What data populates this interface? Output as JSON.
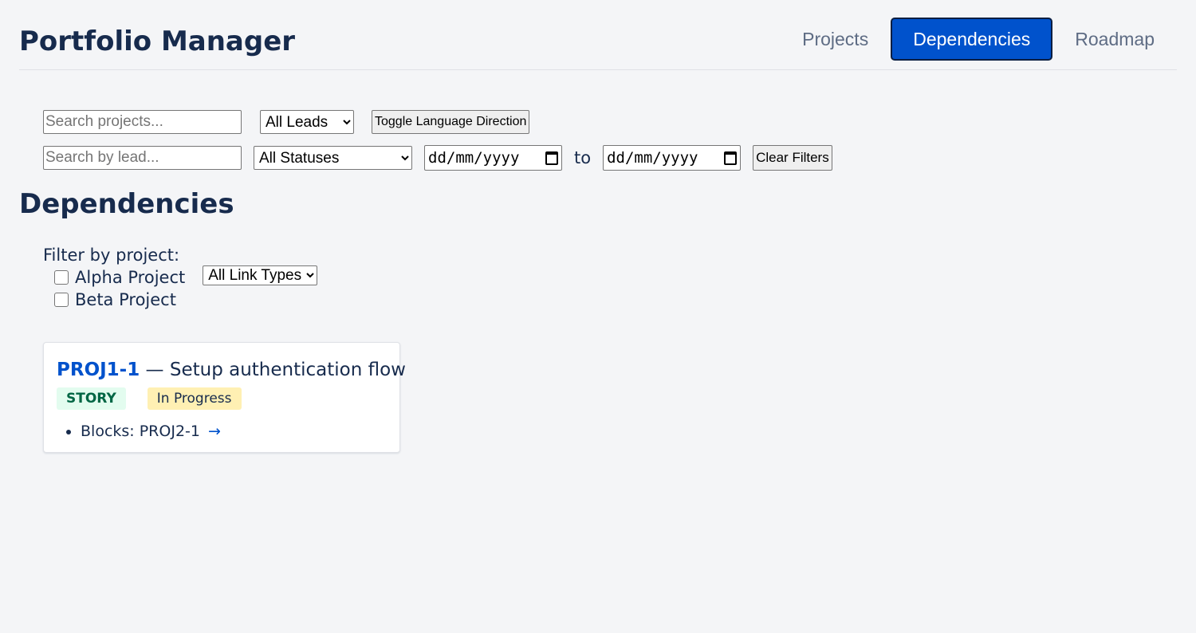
{
  "header": {
    "title": "Portfolio Manager",
    "nav": [
      {
        "label": "Projects",
        "active": false
      },
      {
        "label": "Dependencies",
        "active": true
      },
      {
        "label": "Roadmap",
        "active": false
      }
    ]
  },
  "filters": {
    "search_projects_placeholder": "Search projects...",
    "lead_select_value": "All Leads",
    "toggle_direction_label": "Toggle Language Direction",
    "search_lead_placeholder": "Search by lead...",
    "status_select_value": "All Statuses",
    "date_from_placeholder": "dd/mm/yyyy",
    "to_label": "to",
    "date_to_placeholder": "dd/mm/yyyy",
    "clear_label": "Clear Filters"
  },
  "dependencies": {
    "title": "Dependencies",
    "filter_label": "Filter by project:",
    "projects": [
      "Alpha Project",
      "Beta Project"
    ],
    "link_type_value": "All Link Types"
  },
  "issue": {
    "key": "PROJ1-1",
    "separator": " — ",
    "summary": "Setup authentication flow",
    "type": "STORY",
    "status": "In Progress",
    "links": [
      {
        "label": "Blocks: PROJ2-1",
        "arrow": "→"
      }
    ]
  },
  "colors": {
    "primary": "#0052cc",
    "text": "#172b4d",
    "background": "#f4f5f7",
    "story_bg": "#e3fcef",
    "story_text": "#006644",
    "in_progress_bg": "#fff0b3"
  },
  "icons": {
    "calendar": "calendar-icon"
  }
}
